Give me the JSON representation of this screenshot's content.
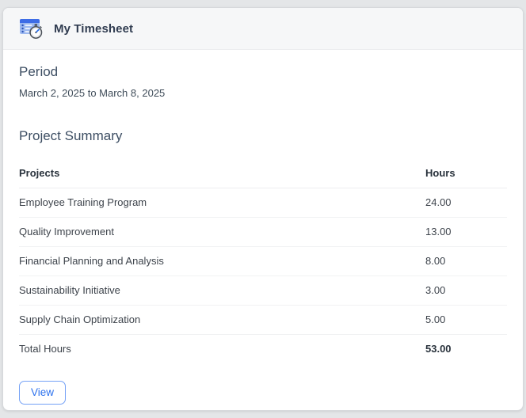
{
  "card": {
    "title": "My Timesheet"
  },
  "period": {
    "heading": "Period",
    "range": "March 2, 2025 to March 8, 2025"
  },
  "summary": {
    "heading": "Project Summary",
    "columns": [
      "Projects",
      "Hours"
    ],
    "rows": [
      {
        "project": "Employee Training Program",
        "hours": "24.00"
      },
      {
        "project": "Quality Improvement",
        "hours": "13.00"
      },
      {
        "project": "Financial Planning and Analysis",
        "hours": "8.00"
      },
      {
        "project": "Sustainability Initiative",
        "hours": "3.00"
      },
      {
        "project": "Supply Chain Optimization",
        "hours": "5.00"
      }
    ],
    "total": {
      "label": "Total Hours",
      "hours": "53.00"
    }
  },
  "actions": {
    "view_label": "View"
  },
  "colors": {
    "accent_blue": "#2d72ee",
    "icon_blue_dark": "#3e6de6",
    "icon_blue_light": "#9db9f0",
    "heading_slate": "#3d4e63",
    "title_navy": "#303c50",
    "header_bg": "#f6f7f8",
    "page_bg": "#e4e6e8"
  }
}
